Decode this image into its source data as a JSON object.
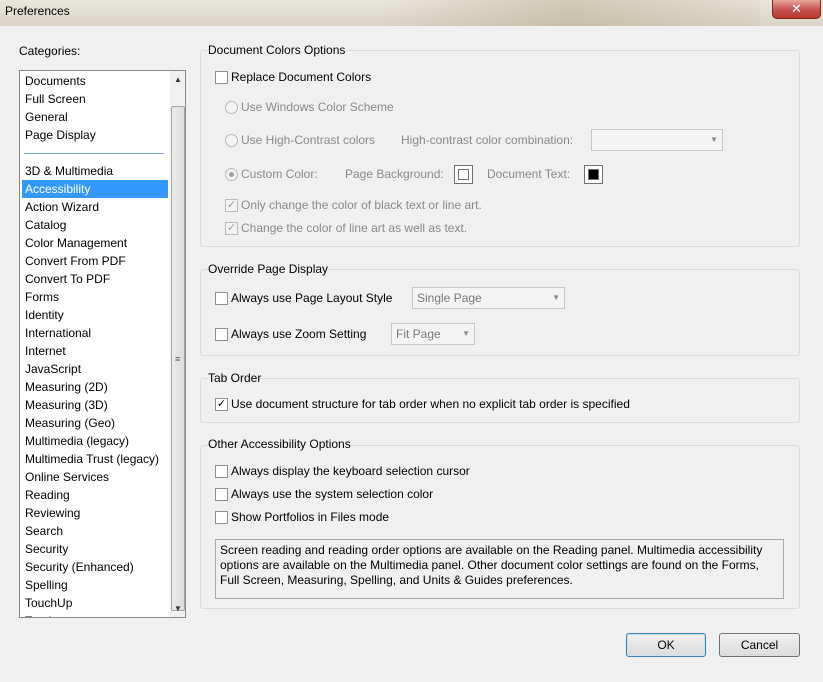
{
  "window": {
    "title": "Preferences",
    "close_glyph": "✕"
  },
  "categories": {
    "label": "Categories:",
    "items": [
      {
        "label": "Documents"
      },
      {
        "label": "Full Screen"
      },
      {
        "label": "General"
      },
      {
        "label": "Page Display"
      },
      {
        "label": "3D & Multimedia"
      },
      {
        "label": "Accessibility",
        "selected": true
      },
      {
        "label": "Action Wizard"
      },
      {
        "label": "Catalog"
      },
      {
        "label": "Color Management"
      },
      {
        "label": "Convert From PDF"
      },
      {
        "label": "Convert To PDF"
      },
      {
        "label": "Forms"
      },
      {
        "label": "Identity"
      },
      {
        "label": "International"
      },
      {
        "label": "Internet"
      },
      {
        "label": "JavaScript"
      },
      {
        "label": "Measuring (2D)"
      },
      {
        "label": "Measuring (3D)"
      },
      {
        "label": "Measuring (Geo)"
      },
      {
        "label": "Multimedia (legacy)"
      },
      {
        "label": "Multimedia Trust (legacy)"
      },
      {
        "label": "Online Services"
      },
      {
        "label": "Reading"
      },
      {
        "label": "Reviewing"
      },
      {
        "label": "Search"
      },
      {
        "label": "Security"
      },
      {
        "label": "Security (Enhanced)"
      },
      {
        "label": "Spelling"
      },
      {
        "label": "TouchUp"
      },
      {
        "label": "Tracker"
      }
    ],
    "scroll_up_glyph": "▲",
    "scroll_down_glyph": "▼",
    "grip_glyph": "≡"
  },
  "document_colors": {
    "title": "Document Colors Options",
    "replace_label": "Replace Document Colors",
    "replace_checked": false,
    "windows_scheme_label": "Use Windows Color Scheme",
    "high_contrast_label": "Use High-Contrast colors",
    "high_contrast_combo_label": "High-contrast color combination:",
    "high_contrast_combo_value": "",
    "custom_color_label": "Custom Color:",
    "page_background_label": "Page Background:",
    "page_background_color": "#ffffff",
    "document_text_label": "Document Text:",
    "document_text_color": "#000000",
    "only_black_label": "Only change the color of black text or line art.",
    "only_black_checked": true,
    "line_art_label": "Change the color of line art as well as text.",
    "line_art_checked": true
  },
  "override_display": {
    "title": "Override Page Display",
    "layout_label": "Always use Page Layout Style",
    "layout_checked": false,
    "layout_value": "Single Page",
    "zoom_label": "Always use Zoom Setting",
    "zoom_checked": false,
    "zoom_value": "Fit Page"
  },
  "tab_order": {
    "title": "Tab Order",
    "structure_label": "Use document structure for tab order when no explicit tab order is specified",
    "structure_checked": true
  },
  "other": {
    "title": "Other Accessibility Options",
    "cursor_label": "Always display the keyboard selection cursor",
    "cursor_checked": false,
    "system_color_label": "Always use the system selection color",
    "system_color_checked": false,
    "portfolios_label": "Show Portfolios in Files mode",
    "portfolios_checked": false,
    "info_text": "Screen reading and reading order options are available on the Reading panel. Multimedia accessibility options are available on the Multimedia panel. Other document color settings are found on the Forms, Full Screen, Measuring, Spelling, and Units & Guides preferences."
  },
  "buttons": {
    "ok": "OK",
    "cancel": "Cancel"
  },
  "icons": {
    "check_glyph": "✓",
    "combo_arrow": "▼"
  },
  "colors": {
    "selection": "#3399ff"
  }
}
